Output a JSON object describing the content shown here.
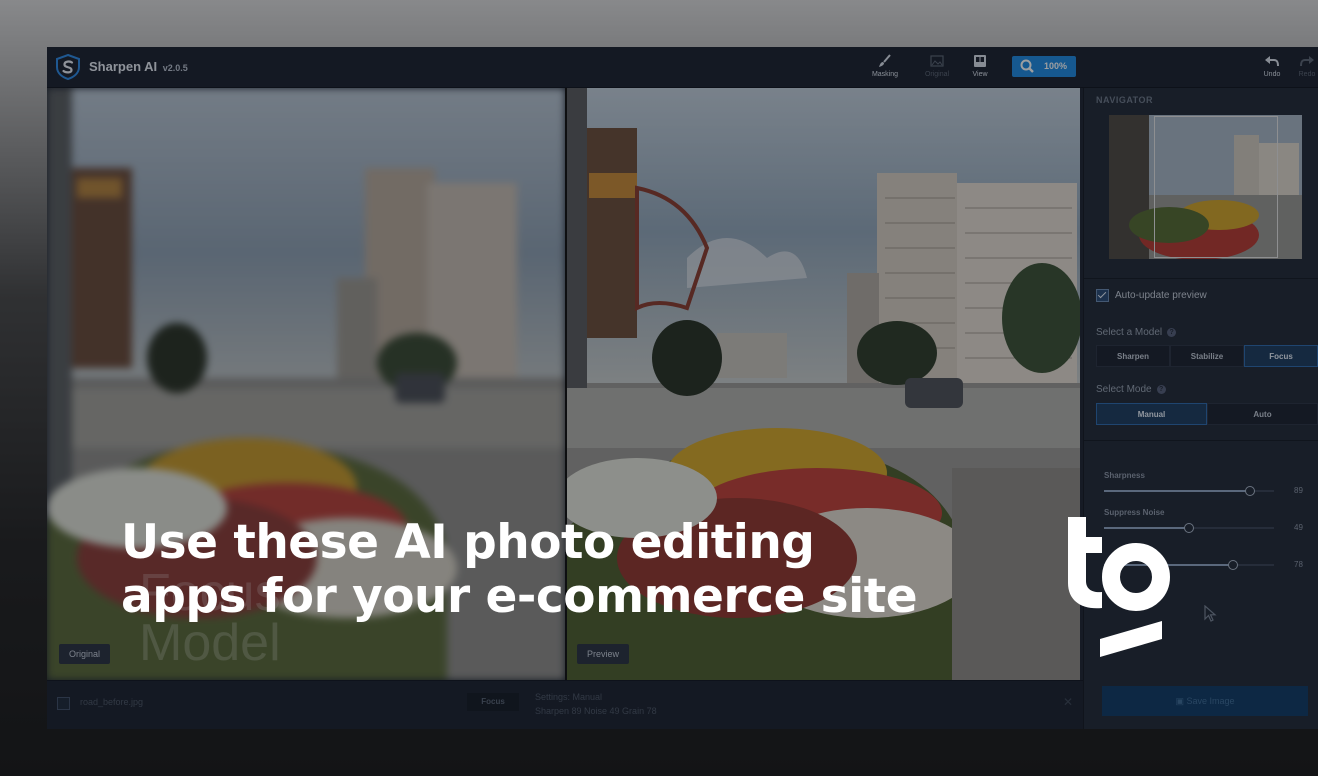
{
  "app": {
    "name": "Sharpen AI",
    "version": "v2.0.5"
  },
  "toolbar": {
    "masking": "Masking",
    "original": "Original",
    "view": "View",
    "zoom": "100%",
    "undo": "Undo",
    "redo": "Redo"
  },
  "canvas": {
    "left_label": "Original",
    "right_label": "Preview",
    "overlay_line1": "Focus",
    "overlay_line2": "Model"
  },
  "panel": {
    "navigator_title": "NAVIGATOR",
    "auto_update": "Auto-update preview",
    "select_model": "Select a Model",
    "models": [
      "Sharpen",
      "Stabilize",
      "Focus"
    ],
    "selected_model": "Focus",
    "select_mode": "Select Mode",
    "modes": [
      "Manual",
      "Auto"
    ],
    "selected_mode": "Manual",
    "sliders": [
      {
        "label": "Sharpness",
        "value": "89"
      },
      {
        "label": "Suppress Noise",
        "value": "49"
      },
      {
        "label": "",
        "value": "78"
      }
    ],
    "save_button": "Save Image"
  },
  "bottombar": {
    "filename": "road_before.jpg",
    "model_badge": "Focus",
    "settings_line1": "Settings: Manual",
    "settings_line2": "Sharpen 89  Noise 49  Grain 78"
  },
  "headline": {
    "line1": "Use these AI photo editing",
    "line2": "apps for your e-commerce site"
  },
  "colors": {
    "accent": "#1f8be3",
    "panel_bg": "#222a38",
    "headline": "#ffffff"
  }
}
